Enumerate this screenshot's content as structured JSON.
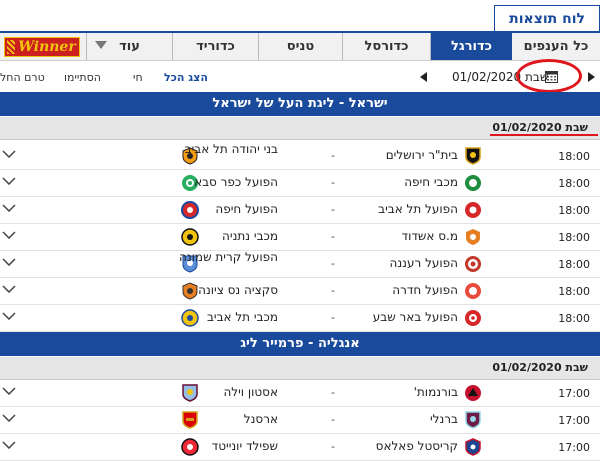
{
  "page_title": "לוח תוצאות",
  "tabs": [
    {
      "label": "כל הענפים",
      "active": false
    },
    {
      "label": "כדורגל",
      "active": true
    },
    {
      "label": "כדורסל",
      "active": false
    },
    {
      "label": "טניס",
      "active": false
    },
    {
      "label": "כדוריד",
      "active": false
    },
    {
      "label": "עוד",
      "active": false
    }
  ],
  "ad_logo_text": "Winner",
  "date_control": {
    "value": "01/02/2020",
    "day": "שבת"
  },
  "filters": [
    {
      "label": "הצג הכל",
      "active": true
    },
    {
      "label": "חי",
      "active": false
    },
    {
      "label": "הסתיימו",
      "active": false
    },
    {
      "label": "טרם החל",
      "active": false
    }
  ],
  "colors": {
    "brand_blue": "#1a4a9c",
    "highlight_red": "#e0161d",
    "date_bar_grey": "#e6e6e6"
  },
  "leagues": [
    {
      "name": "ישראל - ליגת העל של ישראל",
      "date_label": "שבת 01/02/2020",
      "matches": [
        {
          "time": "18:00",
          "home": "בית\"ר ירושלים",
          "away": "בני יהודה תל אביב",
          "score": "-"
        },
        {
          "time": "18:00",
          "home": "מכבי חיפה",
          "away": "הפועל כפר סבא",
          "score": "-"
        },
        {
          "time": "18:00",
          "home": "הפועל תל אביב",
          "away": "הפועל חיפה",
          "score": "-"
        },
        {
          "time": "18:00",
          "home": "מ.ס אשדוד",
          "away": "מכבי נתניה",
          "score": "-"
        },
        {
          "time": "18:00",
          "home": "הפועל רעננה",
          "away": "הפועל קרית שמונה",
          "score": "-"
        },
        {
          "time": "18:00",
          "home": "הפועל חדרה",
          "away": "סקציה נס ציונה",
          "score": "-"
        },
        {
          "time": "18:00",
          "home": "הפועל באר שבע",
          "away": "מכבי תל אביב",
          "score": "-"
        }
      ]
    },
    {
      "name": "אנגליה - פרמייר ליג",
      "date_label": "שבת 01/02/2020",
      "matches": [
        {
          "time": "17:00",
          "home": "בורנמות'",
          "away": "אסטון וילה",
          "score": "-"
        },
        {
          "time": "17:00",
          "home": "ברנלי",
          "away": "ארסנל",
          "score": "-"
        },
        {
          "time": "17:00",
          "home": "קריסטל פאלאס",
          "away": "שפילד יונייטד",
          "score": "-"
        }
      ]
    }
  ]
}
